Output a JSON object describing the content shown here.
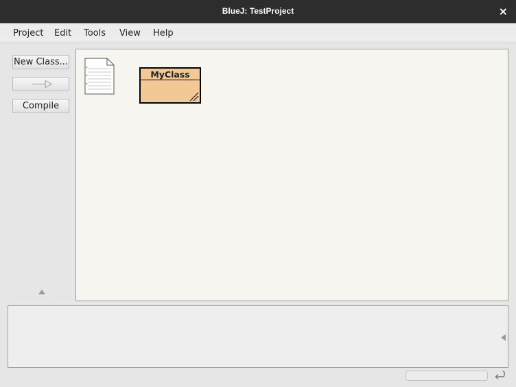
{
  "window": {
    "title": "BlueJ: TestProject",
    "close_glyph": "×"
  },
  "menu": {
    "items": [
      {
        "label": "Project"
      },
      {
        "label": "Edit"
      },
      {
        "label": "Tools"
      },
      {
        "label": "View"
      },
      {
        "label": "Help"
      }
    ]
  },
  "sidebar": {
    "new_class_label": "New Class...",
    "arrow_button_icon": "inheritance-arrow-icon",
    "compile_label": "Compile",
    "scroll_icon": "triangle-up-icon"
  },
  "diagram": {
    "readme_icon": "readme-document-icon",
    "classes": [
      {
        "name": "MyClass",
        "fill_color": "#f2c995"
      }
    ]
  },
  "terminal": {
    "expand_icon": "triangle-left-icon"
  },
  "statusbar": {
    "return_icon": "return-arrow-icon"
  }
}
